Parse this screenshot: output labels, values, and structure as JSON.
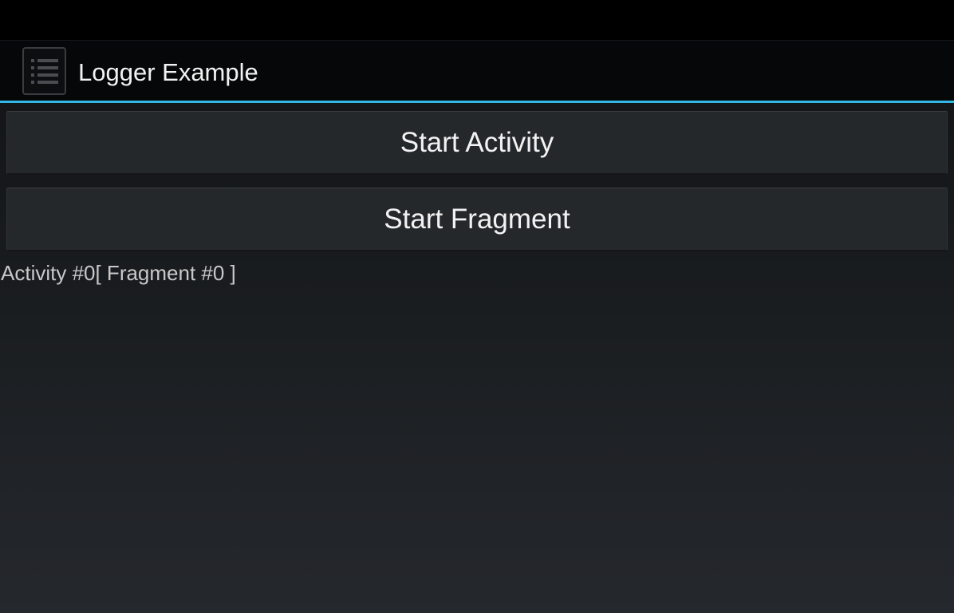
{
  "action_bar": {
    "title": "Logger Example",
    "icon": "list-icon",
    "accent_color": "#33b5e5"
  },
  "buttons": {
    "start_activity": "Start Activity",
    "start_fragment": "Start Fragment"
  },
  "log": {
    "text": "Activity #0[ Fragment #0 ]"
  }
}
